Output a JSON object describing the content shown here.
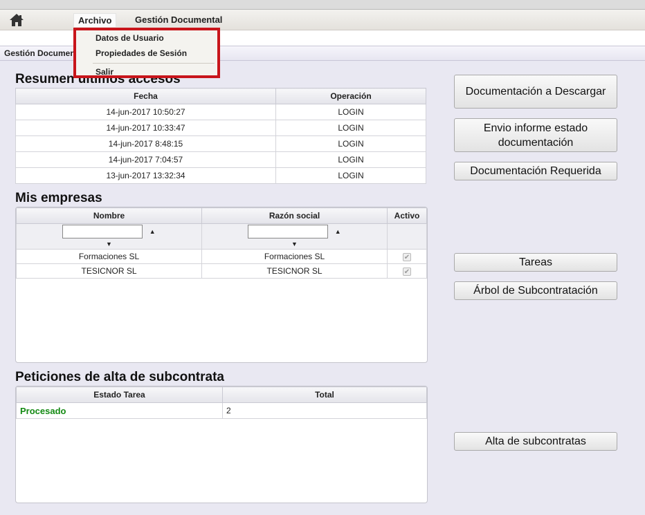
{
  "menubar": {
    "archivo": "Archivo",
    "gestion": "Gestión Documental"
  },
  "dropdown": {
    "datos_usuario": "Datos de Usuario",
    "propiedades_sesion": "Propiedades de Sesión",
    "salir": "Salir"
  },
  "tab": {
    "label": "Gestión Documental"
  },
  "accesos": {
    "title": "Resumen últimos accesos",
    "headers": [
      "Fecha",
      "Operación"
    ],
    "rows": [
      [
        "14-jun-2017 10:50:27",
        "LOGIN"
      ],
      [
        "14-jun-2017 10:33:47",
        "LOGIN"
      ],
      [
        "14-jun-2017 8:48:15",
        "LOGIN"
      ],
      [
        "14-jun-2017 7:04:57",
        "LOGIN"
      ],
      [
        "13-jun-2017 13:32:34",
        "LOGIN"
      ]
    ]
  },
  "empresas": {
    "title": "Mis empresas",
    "headers": [
      "Nombre",
      "Razón social",
      "Activo"
    ],
    "rows": [
      [
        "Formaciones SL",
        "Formaciones SL",
        "✔"
      ],
      [
        "TESICNOR SL",
        "TESICNOR SL",
        "✔"
      ]
    ]
  },
  "peticiones": {
    "title": "Peticiones de alta de subcontrata",
    "headers": [
      "Estado Tarea",
      "Total"
    ],
    "rows": [
      [
        "Procesado",
        "2"
      ]
    ],
    "status_color": "#138a13"
  },
  "buttons": {
    "doc_descargar": "Documentación a Descargar",
    "envio_informe": "Envio informe estado documentación",
    "doc_requerida": "Documentación Requerida",
    "tareas": "Tareas",
    "arbol": "Árbol de Subcontratación",
    "alta_subcontratas": "Alta de subcontratas"
  },
  "colors": {
    "highlight": "#c8151b",
    "page_bg": "#e9e8f2"
  }
}
